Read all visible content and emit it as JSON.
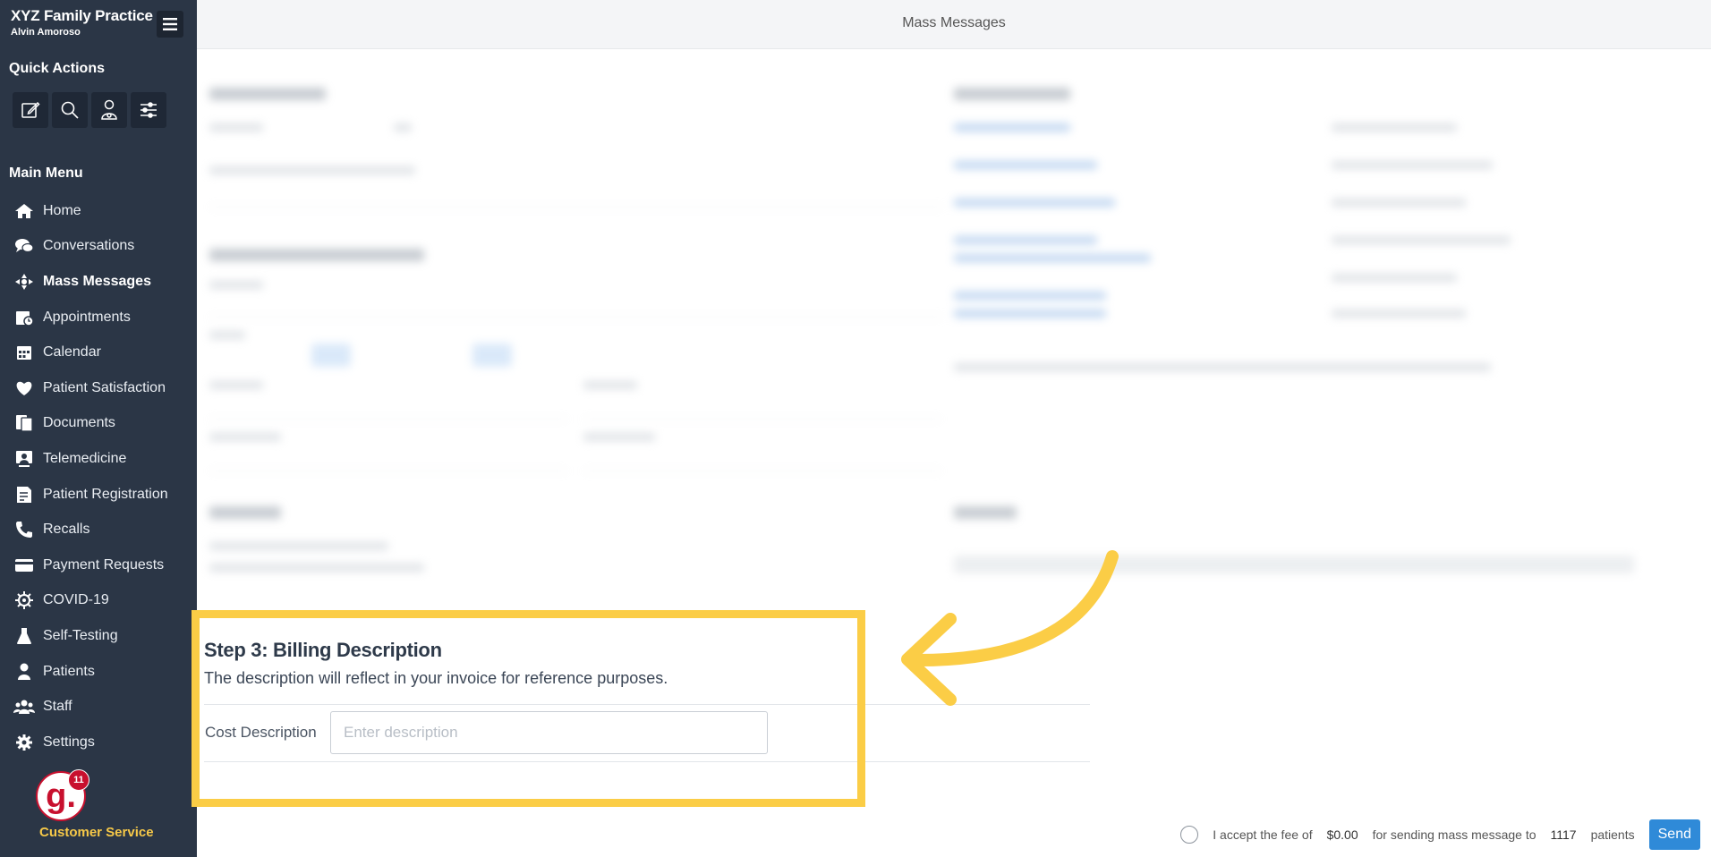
{
  "sidebar": {
    "practice_name": "XYZ Family Practice",
    "user_name": "Alvin Amoroso",
    "quick_actions_title": "Quick Actions",
    "quick_actions": [
      {
        "icon": "compose-icon"
      },
      {
        "icon": "search-icon"
      },
      {
        "icon": "patient-icon"
      },
      {
        "icon": "sliders-icon"
      }
    ],
    "main_menu_title": "Main Menu",
    "items": [
      {
        "label": "Home",
        "icon": "home-icon"
      },
      {
        "label": "Conversations",
        "icon": "chat-icon"
      },
      {
        "label": "Mass Messages",
        "icon": "broadcast-icon",
        "active": true
      },
      {
        "label": "Appointments",
        "icon": "appointment-icon"
      },
      {
        "label": "Calendar",
        "icon": "calendar-icon"
      },
      {
        "label": "Patient Satisfaction",
        "icon": "heart-icon"
      },
      {
        "label": "Documents",
        "icon": "documents-icon"
      },
      {
        "label": "Telemedicine",
        "icon": "telemedicine-icon"
      },
      {
        "label": "Patient Registration",
        "icon": "registration-icon"
      },
      {
        "label": "Recalls",
        "icon": "phone-icon"
      },
      {
        "label": "Payment Requests",
        "icon": "credit-card-icon"
      },
      {
        "label": "COVID-19",
        "icon": "virus-icon"
      },
      {
        "label": "Self-Testing",
        "icon": "flask-icon"
      },
      {
        "label": "Patients",
        "icon": "person-icon"
      },
      {
        "label": "Staff",
        "icon": "staff-icon"
      },
      {
        "label": "Settings",
        "icon": "gear-icon"
      }
    ],
    "customer_service_label": "Customer Service",
    "notification_count": "11",
    "logo_letter": "g."
  },
  "header": {
    "title": "Mass Messages"
  },
  "step3": {
    "title": "Step 3: Billing Description",
    "description": "The description will reflect in your invoice for reference purposes.",
    "cost_label": "Cost Description",
    "cost_placeholder": "Enter description",
    "cost_value": ""
  },
  "footer": {
    "accept_text": "I accept the fee of",
    "fee": "$0.00",
    "sending_text": "for sending mass message to",
    "patient_count": "1117",
    "patients_text": "patients",
    "send_label": "Send"
  },
  "colors": {
    "sidebar_bg": "#2b3646",
    "highlight": "#fbcd46",
    "send_button": "#2f8ad8",
    "customer_service": "#f7c948"
  }
}
